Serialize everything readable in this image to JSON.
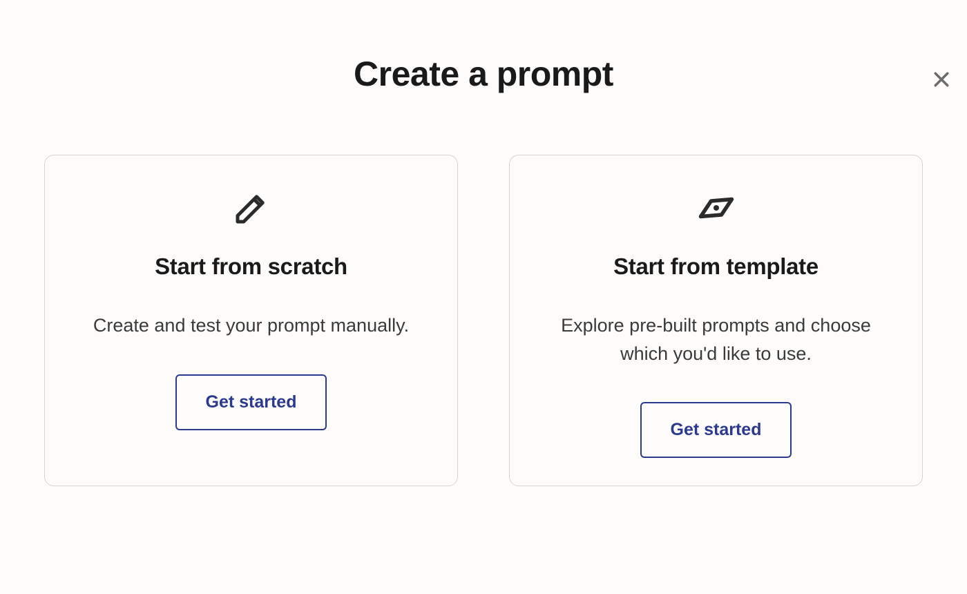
{
  "modal": {
    "title": "Create a prompt"
  },
  "cards": {
    "scratch": {
      "title": "Start from scratch",
      "description": "Create and test your prompt manually.",
      "button_label": "Get started"
    },
    "template": {
      "title": "Start from template",
      "description": "Explore pre-built prompts and choose which you'd like to use.",
      "button_label": "Get started"
    }
  }
}
